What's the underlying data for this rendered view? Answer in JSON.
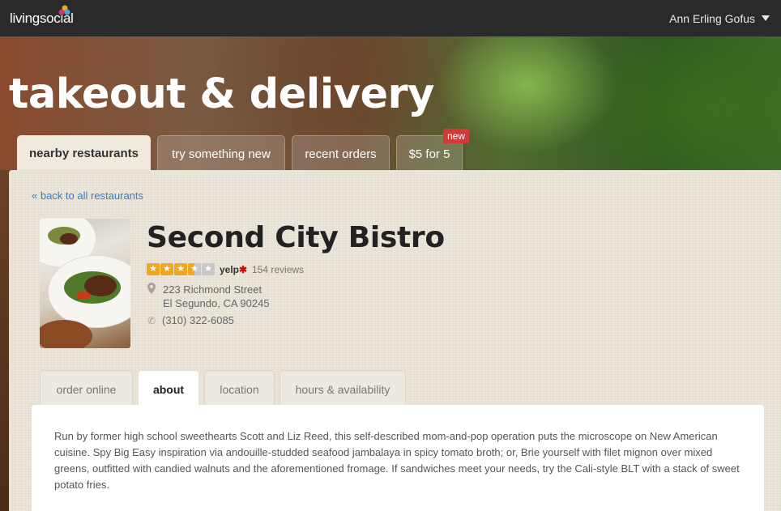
{
  "header": {
    "logo_text": "livingsocial",
    "user_name": "Ann Erling Gofus"
  },
  "hero": {
    "title": "takeout & delivery"
  },
  "main_tabs": [
    {
      "label": "nearby restaurants",
      "active": true
    },
    {
      "label": "try something new",
      "active": false
    },
    {
      "label": "recent orders",
      "active": false
    },
    {
      "label": "$5 for 5",
      "active": false,
      "badge": "new"
    }
  ],
  "back_link": "« back to all restaurants",
  "restaurant": {
    "name": "Second City Bistro",
    "rating": 3.5,
    "rating_max": 5,
    "rating_source": "yelp",
    "reviews": "154 reviews",
    "address_line1": "223 Richmond Street",
    "address_line2": "El Segundo, CA 90245",
    "phone": "(310) 322-6085"
  },
  "sub_tabs": [
    {
      "label": "order online",
      "active": false
    },
    {
      "label": "about",
      "active": true
    },
    {
      "label": "location",
      "active": false
    },
    {
      "label": "hours & availability",
      "active": false
    }
  ],
  "about_text": "Run by former high school sweethearts Scott and Liz Reed, this self-described mom-and-pop operation puts the microscope on New American cuisine. Spy Big Easy inspiration via andouille-studded seafood jambalaya in spicy tomato broth; or, Brie yourself with filet mignon over mixed greens, outfitted with candied walnuts and the aforementioned fromage. If sandwiches meet your needs, try the Cali-style BLT with a stack of sweet potato fries.",
  "colors": {
    "topbar": "#2a2a2a",
    "link": "#3b7bbf",
    "star": "#f0a81e",
    "badge": "#d23a3a",
    "yelp_red": "#c41200"
  }
}
